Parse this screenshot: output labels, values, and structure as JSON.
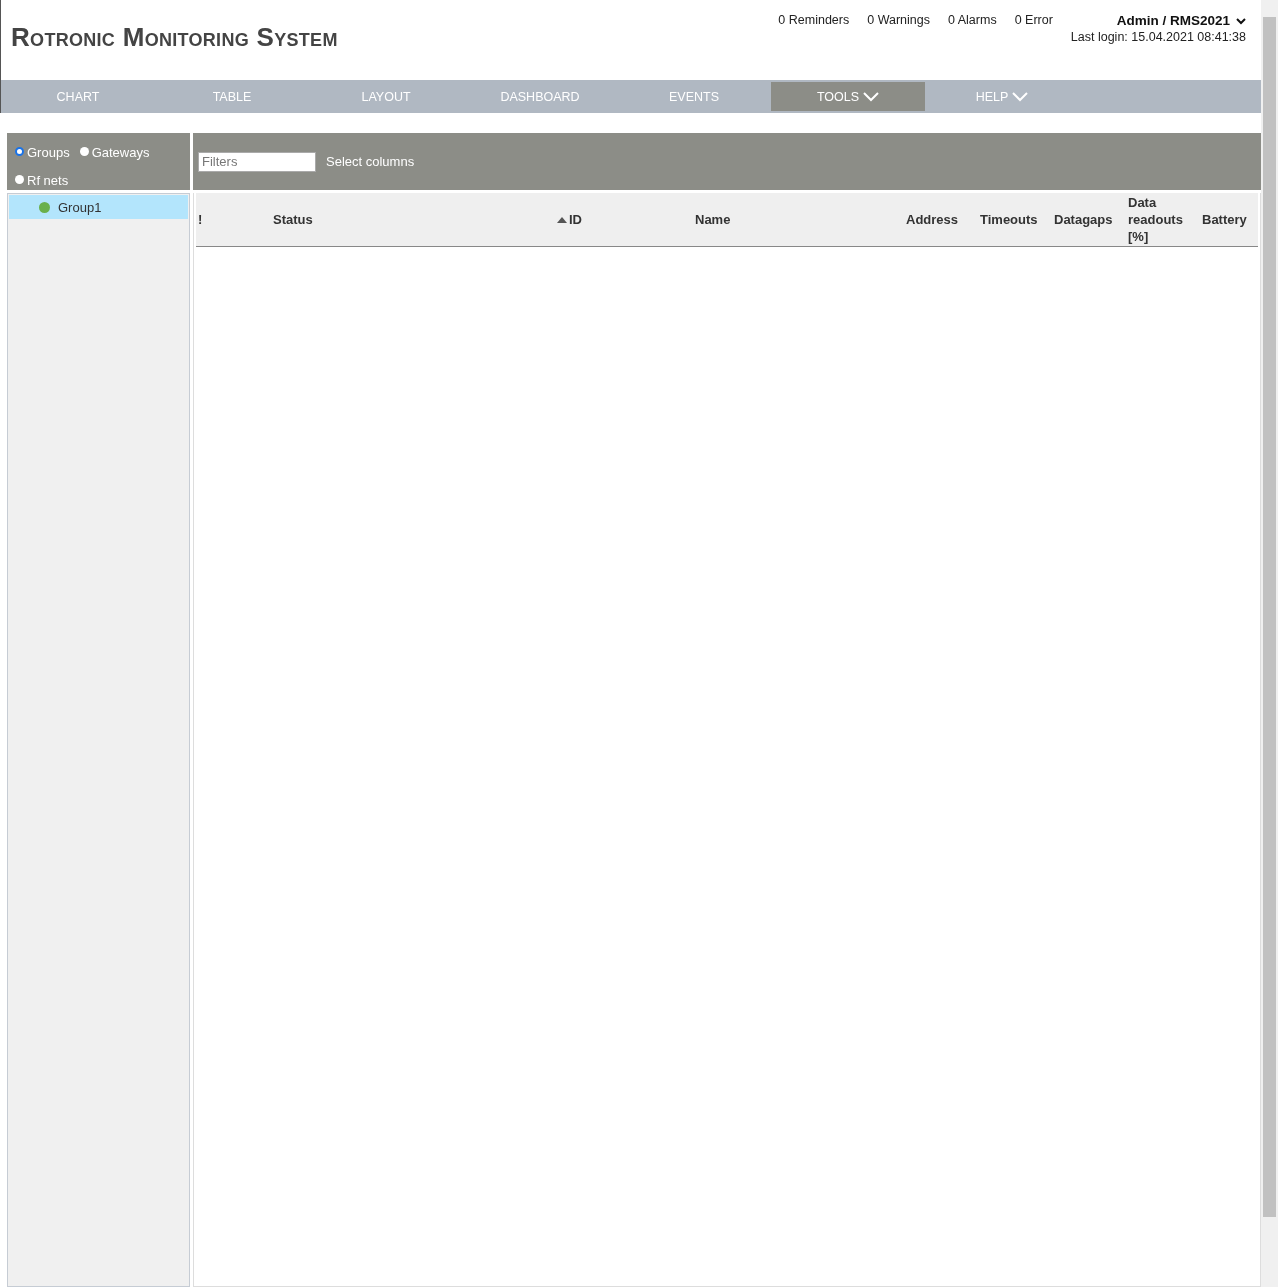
{
  "app": {
    "title": "Rotronic Monitoring System"
  },
  "notifications": [
    {
      "label": "0 Reminders"
    },
    {
      "label": "0 Warnings"
    },
    {
      "label": "0 Alarms"
    },
    {
      "label": "0 Error"
    }
  ],
  "user": {
    "name": "Admin / RMS2021",
    "last_login": "Last login: 15.04.2021 08:41:38"
  },
  "nav": [
    {
      "label": "CHART",
      "selected": false,
      "dropdown": false
    },
    {
      "label": "TABLE",
      "selected": false,
      "dropdown": false
    },
    {
      "label": "LAYOUT",
      "selected": false,
      "dropdown": false
    },
    {
      "label": "DASHBOARD",
      "selected": false,
      "dropdown": false
    },
    {
      "label": "EVENTS",
      "selected": false,
      "dropdown": false
    },
    {
      "label": "TOOLS",
      "selected": true,
      "dropdown": true
    },
    {
      "label": "HELP",
      "selected": false,
      "dropdown": true
    }
  ],
  "sidebar": {
    "views": [
      {
        "label": "Groups",
        "selected": true
      },
      {
        "label": "Gateways",
        "selected": false
      },
      {
        "label": "Rf nets",
        "selected": false
      }
    ],
    "tree": [
      {
        "label": "Group1",
        "selected": true,
        "color": "#6ab04c"
      }
    ]
  },
  "toolbar": {
    "filter": {
      "placeholder": "Filters"
    },
    "select_columns": "Select columns"
  },
  "table": {
    "columns": [
      {
        "label": "!",
        "sorted": false
      },
      {
        "label": "Status",
        "sorted": false
      },
      {
        "label": "ID",
        "sorted": true
      },
      {
        "label": "Name",
        "sorted": false
      },
      {
        "label": "Address",
        "sorted": false
      },
      {
        "label": "Timeouts",
        "sorted": false
      },
      {
        "label": "Datagaps",
        "sorted": false
      },
      {
        "label": "Data readouts [%]",
        "sorted": false
      },
      {
        "label": "Battery",
        "sorted": false
      }
    ]
  }
}
